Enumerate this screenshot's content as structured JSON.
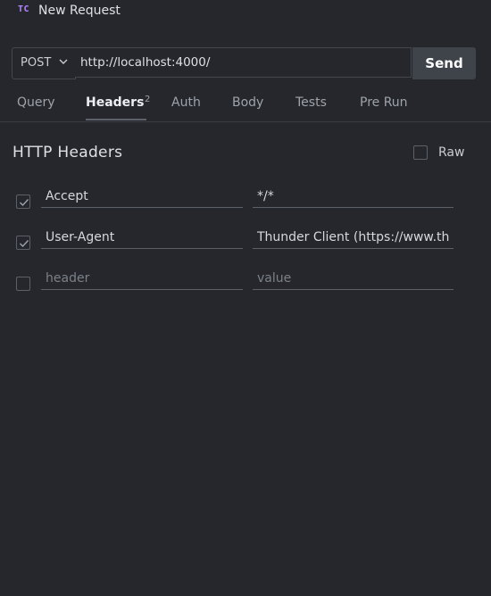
{
  "window": {
    "logo_text": "TC",
    "title": "New Request"
  },
  "request": {
    "method": "POST",
    "url": "http://localhost:4000/",
    "send_label": "Send"
  },
  "tabs": [
    {
      "label": "Query"
    },
    {
      "label": "Headers",
      "badge": "2",
      "active": true
    },
    {
      "label": "Auth"
    },
    {
      "label": "Body"
    },
    {
      "label": "Tests"
    },
    {
      "label": "Pre Run"
    }
  ],
  "headers_panel": {
    "title": "HTTP Headers",
    "raw_label": "Raw",
    "raw_checked": false,
    "rows": [
      {
        "checked": true,
        "key": "Accept",
        "value": "*/*"
      },
      {
        "checked": true,
        "key": "User-Agent",
        "value": "Thunder Client (https://www.th"
      },
      {
        "checked": false,
        "key": "",
        "value": "",
        "key_placeholder": "header",
        "value_placeholder": "value"
      }
    ]
  },
  "colors": {
    "background": "#25272c",
    "logo": "#b388ff",
    "send_button": "#3f434a"
  }
}
